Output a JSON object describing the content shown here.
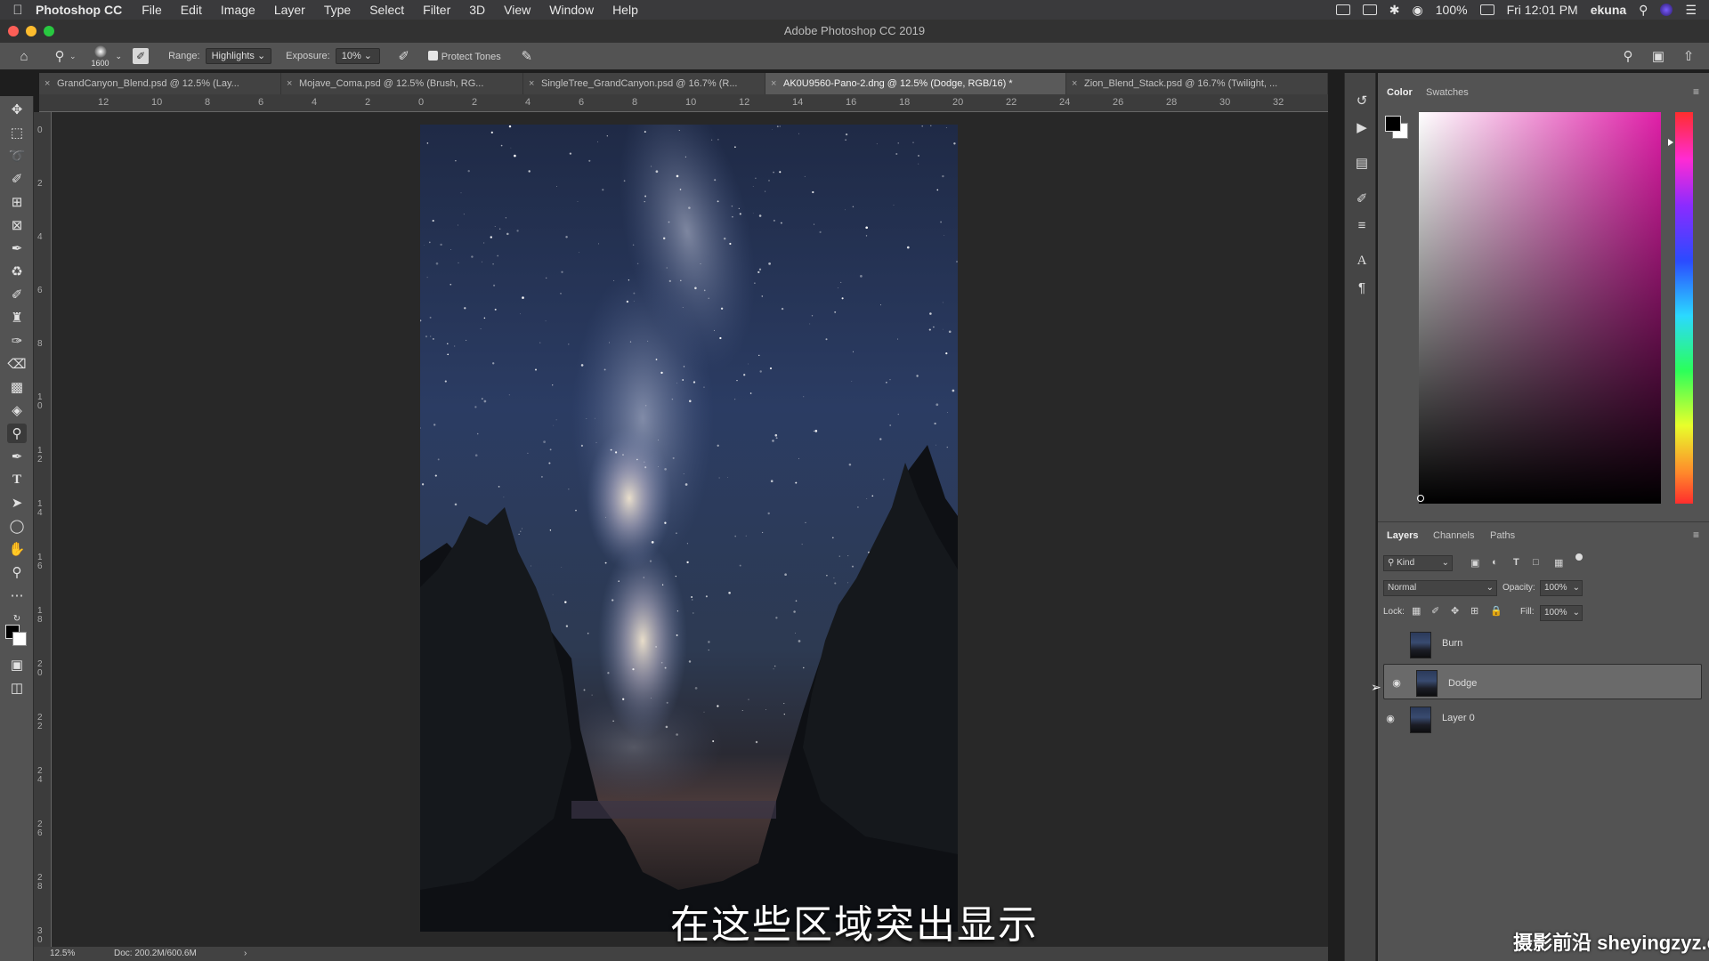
{
  "menubar": {
    "app_name": "Photoshop CC",
    "items": [
      "File",
      "Edit",
      "Image",
      "Layer",
      "Type",
      "Select",
      "Filter",
      "3D",
      "View",
      "Window",
      "Help"
    ],
    "battery": "100%",
    "clock": "Fri 12:01 PM",
    "user": "ekuna"
  },
  "window": {
    "title": "Adobe Photoshop CC 2019"
  },
  "options": {
    "brush_size": "1600",
    "range_label": "Range:",
    "range_value": "Highlights",
    "exposure_label": "Exposure:",
    "exposure_value": "10%",
    "protect_tones": "Protect Tones"
  },
  "tabs": [
    {
      "label": "GrandCanyon_Blend.psd @ 12.5% (Lay...",
      "active": false
    },
    {
      "label": "Mojave_Coma.psd @ 12.5% (Brush, RG...",
      "active": false
    },
    {
      "label": "SingleTree_GrandCanyon.psd @ 16.7% (R...",
      "active": false
    },
    {
      "label": "AK0U9560-Pano-2.dng @ 12.5% (Dodge, RGB/16) *",
      "active": true
    },
    {
      "label": "Zion_Blend_Stack.psd @ 16.7% (Twilight, ...",
      "active": false
    }
  ],
  "ruler_h": [
    "12",
    "10",
    "8",
    "6",
    "4",
    "2",
    "0",
    "2",
    "4",
    "6",
    "8",
    "10",
    "12",
    "14",
    "16",
    "18",
    "20",
    "22",
    "24",
    "26",
    "28",
    "30",
    "32"
  ],
  "ruler_v": [
    "0",
    "2",
    "4",
    "6",
    "8",
    "1 0",
    "1 2",
    "1 4",
    "1 6",
    "1 8",
    "2 0",
    "2 2",
    "2 4",
    "2 6",
    "2 8",
    "3 0"
  ],
  "status": {
    "zoom": "12.5%",
    "doc": "Doc: 200.2M/600.6M"
  },
  "color_panel": {
    "tab_color": "Color",
    "tab_swatches": "Swatches"
  },
  "layers_panel": {
    "tab_layers": "Layers",
    "tab_channels": "Channels",
    "tab_paths": "Paths",
    "filter_kind": "Kind",
    "blend_mode": "Normal",
    "opacity_label": "Opacity:",
    "opacity_value": "100%",
    "lock_label": "Lock:",
    "fill_label": "Fill:",
    "fill_value": "100%",
    "layers": [
      {
        "name": "Burn",
        "visible": false,
        "selected": false
      },
      {
        "name": "Dodge",
        "visible": true,
        "selected": true
      },
      {
        "name": "Layer 0",
        "visible": true,
        "selected": false
      }
    ]
  },
  "subtitle": "在这些区域突出显示",
  "watermark": "摄影前沿 sheyingzyz.com",
  "colors": {
    "accent_magenta": "#e01fa8",
    "panel_bg": "#535353",
    "canvas_bg": "#282828"
  }
}
